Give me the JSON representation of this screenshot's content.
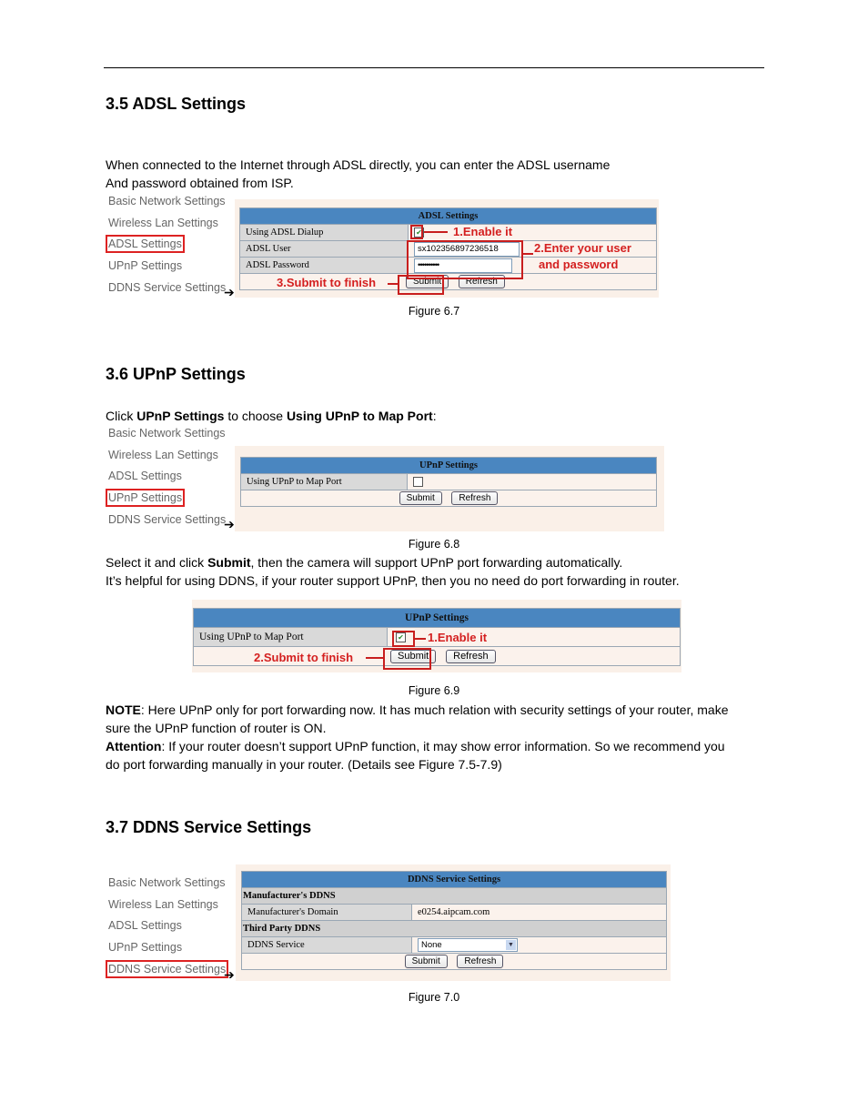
{
  "sections": {
    "adsl": {
      "heading": "3.5 ADSL Settings",
      "intro_line1": "When connected to the Internet through ADSL directly, you can enter the ADSL username",
      "intro_line2": "And password obtained from ISP.",
      "caption": "Figure 6.7"
    },
    "upnp": {
      "heading": "3.6 UPnP Settings",
      "intro_pre": "Click ",
      "intro_bold1": "UPnP Settings",
      "intro_mid": " to choose ",
      "intro_bold2": "Using UPnP to Map Port",
      "intro_post": ":",
      "caption1": "Figure 6.8",
      "para1_pre": "Select it and click ",
      "para1_bold": "Submit",
      "para1_post": ", then the camera will support UPnP port forwarding automatically.",
      "para2": "It’s helpful for using DDNS, if your router support UPnP, then you no need do port forwarding in router.",
      "caption2": "Figure 6.9",
      "note_label": "NOTE",
      "note_text": ": Here UPnP only for port forwarding now. It has much relation with security settings of your router, make",
      "note_text2": "sure the UPnP function of router is ON.",
      "attention_label": "Attention",
      "attention_text": ": If your router doesn’t support UPnP function, it may show error information. So we recommend you",
      "attention_text2": "do port forwarding manually in your router. (Details see Figure 7.5-7.9)"
    },
    "ddns": {
      "heading": "3.7 DDNS Service Settings",
      "caption": "Figure 7.0"
    }
  },
  "nav_items": [
    "Basic Network Settings",
    "Wireless Lan Settings",
    "ADSL Settings",
    "UPnP Settings",
    "DDNS Service Settings"
  ],
  "arrow": "➔",
  "adsl_panel": {
    "title": "ADSL Settings",
    "rows": [
      {
        "label": "Using ADSL Dialup",
        "checked": true
      },
      {
        "label": "ADSL User",
        "value": "sx102356897236518"
      },
      {
        "label": "ADSL Password",
        "value": "••••••••••"
      }
    ],
    "submit": "Submit",
    "refresh": "Refresh",
    "annotations": [
      "1.Enable it",
      "2.Enter your user",
      "and password",
      "3.Submit to finish"
    ]
  },
  "upnp_panel": {
    "title": "UPnP Settings",
    "row_label": "Using UPnP to Map Port",
    "checked": false,
    "submit": "Submit",
    "refresh": "Refresh"
  },
  "upnp_panel2": {
    "title": "UPnP Settings",
    "row_label": "Using UPnP to Map Port",
    "checked": true,
    "submit": "Submit",
    "refresh": "Refresh",
    "annotations": [
      "1.Enable it",
      "2.Submit to finish"
    ]
  },
  "ddns_panel": {
    "title": "DDNS Service Settings",
    "group1": "Manufacturer's DDNS",
    "domain_label": "Manufacturer's Domain",
    "domain_value": "e0254.aipcam.com",
    "group2": "Third Party DDNS",
    "service_label": "DDNS Service",
    "service_value": "None",
    "submit": "Submit",
    "refresh": "Refresh"
  },
  "colors": {
    "header_blue": "#4a86c0",
    "highlight_red": "#c81e1e",
    "panel_bg": "#faf0e8"
  }
}
